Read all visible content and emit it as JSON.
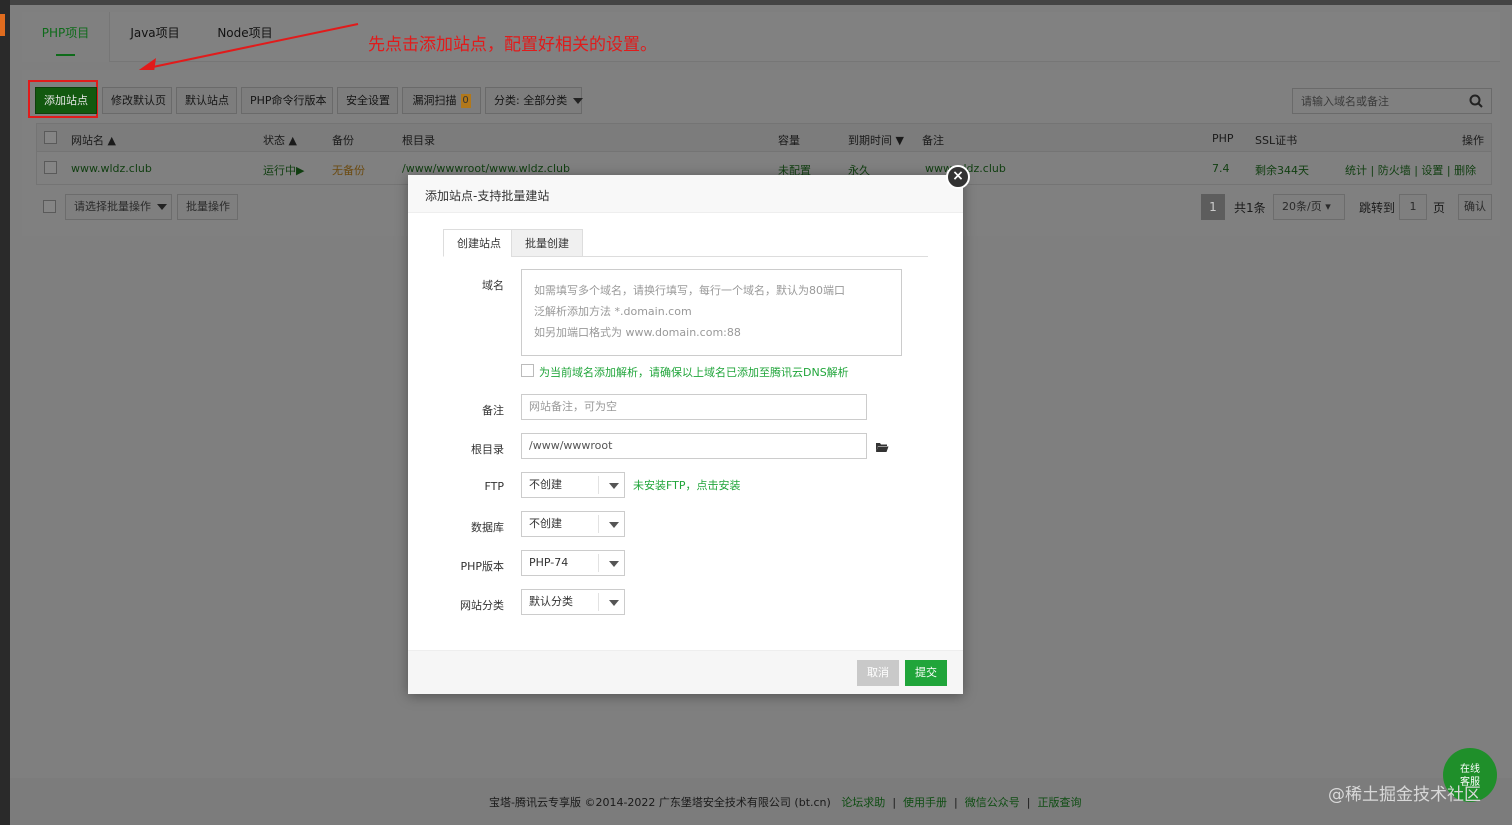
{
  "project_tabs": [
    "PHP项目",
    "Java项目",
    "Node项目"
  ],
  "annotation": "先点击添加站点，配置好相关的设置。",
  "toolbar": {
    "add_site": "添加站点",
    "edit_default_page": "修改默认页",
    "default_site": "默认站点",
    "php_cli_version": "PHP命令行版本",
    "security_settings": "安全设置",
    "vuln_scan": "漏洞扫描",
    "vuln_count": "0",
    "category": "分类: 全部分类"
  },
  "search": {
    "placeholder": "请输入域名或备注"
  },
  "table": {
    "headers": {
      "site_name": "网站名",
      "status": "状态",
      "backup": "备份",
      "root": "根目录",
      "capacity": "容量",
      "expiry": "到期时间",
      "remark": "备注",
      "php": "PHP",
      "ssl": "SSL证书",
      "ops": "操作"
    },
    "row": {
      "site_name": "www.wldz.club",
      "status": "运行中▶",
      "backup": "无备份",
      "root": "/www/wwwroot/www.wldz.club",
      "capacity": "未配置",
      "expiry": "永久",
      "remark": "www.wldz.club",
      "php": "7.4",
      "ssl": "剩余344天",
      "ops": [
        "统计",
        "防火墙",
        "设置",
        "删除"
      ]
    }
  },
  "batch": {
    "select_placeholder": "请选择批量操作",
    "batch_button": "批量操作"
  },
  "pager": {
    "current": "1",
    "total": "共1条",
    "per_page": "20条/页",
    "jump_label": "跳转到",
    "jump_value": "1",
    "page_unit": "页",
    "confirm": "确认"
  },
  "modal": {
    "title": "添加站点-支持批量建站",
    "tabs": [
      "创建站点",
      "批量创建"
    ],
    "domain_label": "域名",
    "domain_placeholder_lines": [
      "如需填写多个域名，请换行填写，每行一个域名，默认为80端口",
      "泛解析添加方法 *.domain.com",
      "如另加端口格式为 www.domain.com:88"
    ],
    "dns_checkbox": "为当前域名添加解析，请确保以上域名已添加至腾讯云DNS解析",
    "remark_label": "备注",
    "remark_placeholder": "网站备注，可为空",
    "root_label": "根目录",
    "root_value": "/www/wwwroot",
    "ftp_label": "FTP",
    "ftp_value": "不创建",
    "ftp_note": "未安装FTP，点击安装",
    "db_label": "数据库",
    "db_value": "不创建",
    "php_label": "PHP版本",
    "php_value": "PHP-74",
    "category_label": "网站分类",
    "category_value": "默认分类",
    "cancel": "取消",
    "submit": "提交"
  },
  "footer": {
    "copyright": "宝塔-腾讯云专享版 ©2014-2022 广东堡塔安全技术有限公司 (bt.cn)",
    "links": [
      "论坛求助",
      "使用手册",
      "微信公众号",
      "正版查询"
    ],
    "separator": "|"
  },
  "support_bubble": [
    "在线",
    "客服"
  ],
  "watermark": "@稀土掘金技术社区",
  "colors": {
    "accent_green": "#20a53a",
    "annotation_red": "#e11b1b",
    "overlay_gray": "#7f7f7f"
  }
}
